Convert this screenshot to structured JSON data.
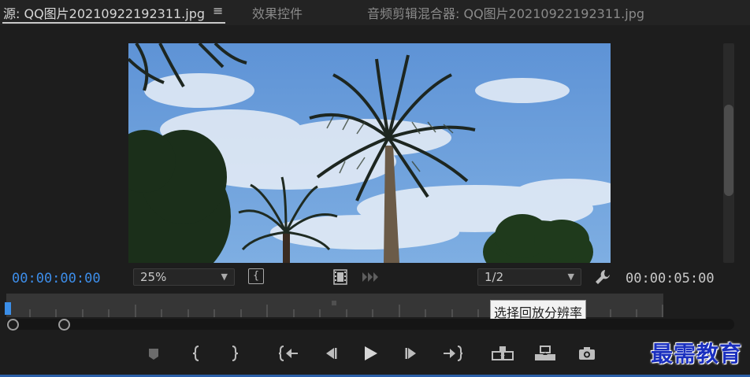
{
  "tabs": [
    {
      "label": "源: QQ图片20210922192311.jpg",
      "active": true
    },
    {
      "label": "效果控件",
      "active": false
    },
    {
      "label": "音频剪辑混合器: QQ图片20210922192311.jpg",
      "active": false
    }
  ],
  "tab_menu_icon": "hamburger-menu-icon",
  "viewer": {
    "scene": "palm-trees-blue-sky"
  },
  "controls": {
    "timecode_current": "00:00:00:00",
    "timecode_duration": "00:00:05:00",
    "zoom_value": "25%",
    "resolution_value": "1/2",
    "tooltip": "选择回放分辨率"
  },
  "colors": {
    "timecode_accent": "#3d8eea",
    "watermark": "#1a2fbf"
  },
  "transport_icons": [
    "add-marker-icon",
    "mark-in-icon",
    "mark-out-icon",
    "go-to-in-icon",
    "step-back-icon",
    "play-icon",
    "step-forward-icon",
    "go-to-out-icon",
    "insert-icon",
    "overwrite-icon",
    "export-frame-icon"
  ],
  "watermark": "最需教育"
}
